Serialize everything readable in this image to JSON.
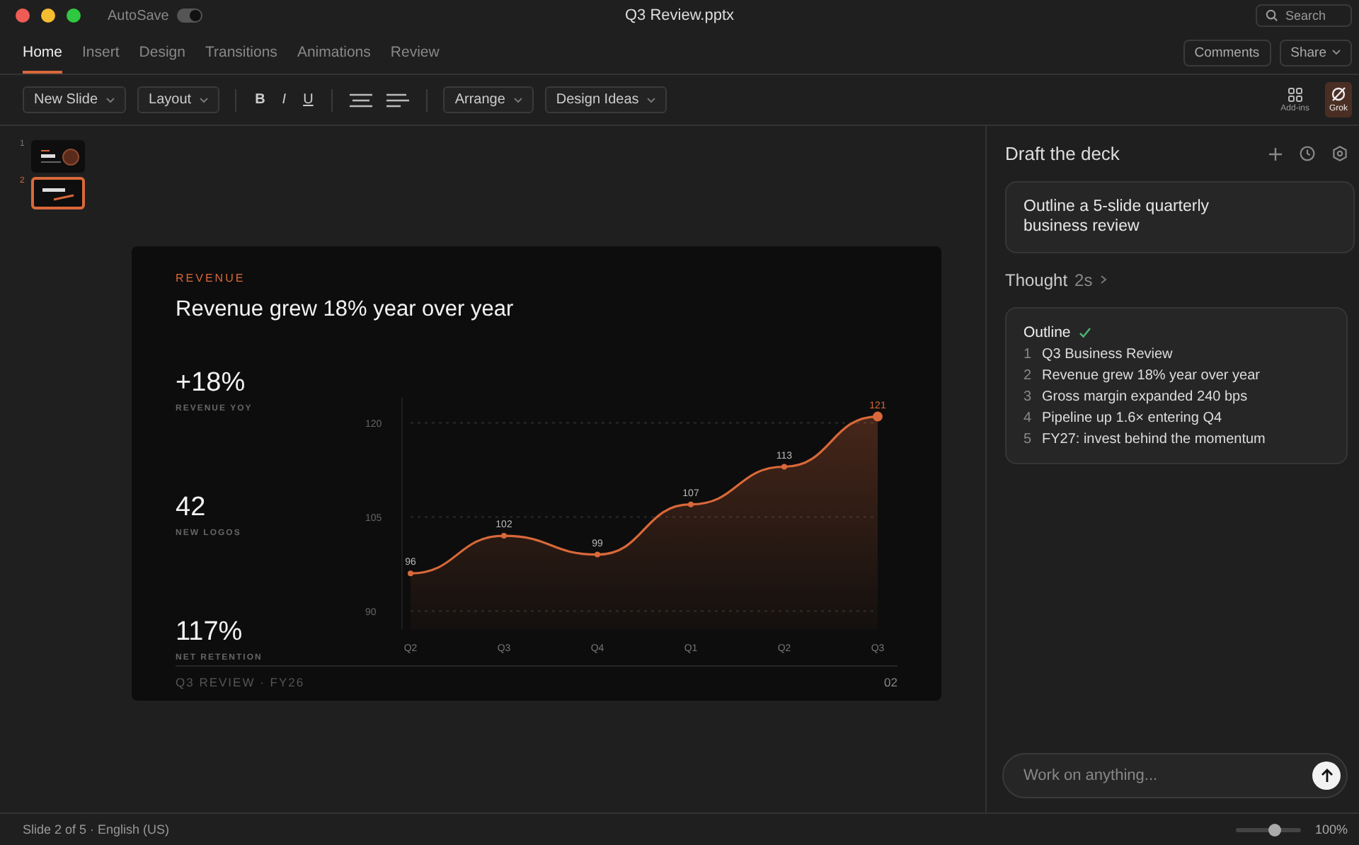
{
  "window": {
    "title": "Q3 Review.pptx",
    "autosave": {
      "label": "AutoSave",
      "on": true
    }
  },
  "search": {
    "placeholder": "Search"
  },
  "tabs": [
    {
      "label": "Home",
      "selected": true
    },
    {
      "label": "Insert",
      "selected": false
    },
    {
      "label": "Design",
      "selected": false
    },
    {
      "label": "Transitions",
      "selected": false
    },
    {
      "label": "Animations",
      "selected": false
    },
    {
      "label": "Review",
      "selected": false
    }
  ],
  "header_buttons": [
    {
      "label": "Comments",
      "dropdown": false
    },
    {
      "label": "Share",
      "dropdown": true
    }
  ],
  "toolbar": {
    "left": [
      {
        "label": "New Slide"
      },
      {
        "label": "Layout"
      }
    ],
    "format": [
      {
        "label": "B",
        "kind": "bold"
      },
      {
        "label": "I",
        "kind": "italic"
      },
      {
        "label": "U",
        "kind": "underline"
      }
    ],
    "right": [
      {
        "label": "Arrange"
      },
      {
        "label": "Design Ideas"
      }
    ],
    "tools": [
      {
        "label": "Add-ins",
        "kind": "grid",
        "selected": false
      },
      {
        "label": "Grok",
        "kind": "grok",
        "selected": true
      }
    ]
  },
  "thumbnails": [
    {
      "number": "1",
      "selected": false
    },
    {
      "number": "2",
      "selected": true
    }
  ],
  "slide": {
    "eyebrow": "REVENUE",
    "title": "Revenue grew 18% year over year",
    "stats": [
      {
        "value": "+18%",
        "label": "REVENUE YOY"
      },
      {
        "value": "42",
        "label": "NEW LOGOS"
      },
      {
        "value": "117%",
        "label": "NET RETENTION"
      }
    ],
    "chart_data": {
      "type": "area",
      "categories": [
        "Q2",
        "Q3",
        "Q4",
        "Q1",
        "Q2",
        "Q3"
      ],
      "series": [
        {
          "color": "#d9683a",
          "values": [
            96,
            102,
            99,
            107,
            113,
            121
          ]
        }
      ],
      "ylim": [
        87,
        124
      ],
      "yticks": [
        90,
        105,
        120
      ],
      "grid": true,
      "data_labels": true
    },
    "footer": "Q3 REVIEW · FY26",
    "page": "02"
  },
  "panel": {
    "title": "Draft the deck",
    "prompt": "Outline a 5-slide quarterly business review",
    "thought": {
      "label": "Thought",
      "time": "2s"
    },
    "outline": {
      "title": "Outline",
      "done": true,
      "items": [
        {
          "number": "1",
          "text": "Q3 Business Review"
        },
        {
          "number": "2",
          "text": "Revenue grew 18% year over year"
        },
        {
          "number": "3",
          "text": "Gross margin expanded 240 bps"
        },
        {
          "number": "4",
          "text": "Pipeline up 1.6× entering Q4"
        },
        {
          "number": "5",
          "text": "FY27: invest behind the momentum"
        }
      ]
    },
    "input": {
      "placeholder": "Work on anything..."
    }
  },
  "status_bar": {
    "text": "Slide 2 of 5 · English (US)",
    "zoom": {
      "level": 0.6,
      "reading": "100%"
    }
  }
}
